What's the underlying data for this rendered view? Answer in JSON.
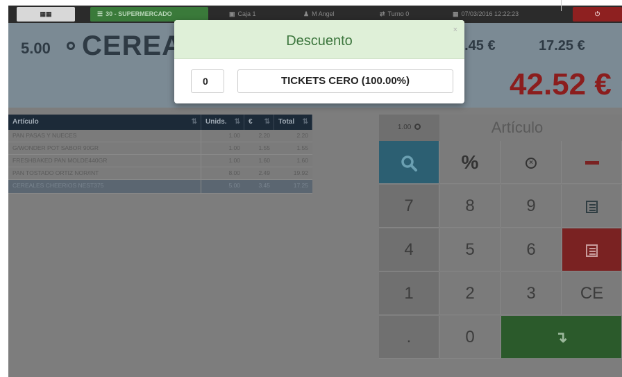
{
  "topbar": {
    "store_label": "30 - SUPERMERCADO",
    "register_label": "Caja 1",
    "user_label": "M Angel",
    "shift_label": "Turno 0",
    "datetime": "07/03/2016 12:22:23"
  },
  "display": {
    "quantity": "5.00",
    "article_name": "CEREAL",
    "unit_price": "3.45 €",
    "line_total": "17.25 €",
    "ticket_total": "42.52 €"
  },
  "table": {
    "headers": [
      "Artículo",
      "Unids.",
      "€",
      "Total"
    ],
    "rows": [
      [
        "PAN PASAS Y NUECES",
        "1.00",
        "2.20",
        "2.20"
      ],
      [
        "G/WONDER POT SABOR 90GR",
        "1.00",
        "1.55",
        "1.55"
      ],
      [
        "FRESHBAKED PAN MOLDE440GR",
        "1.00",
        "1.60",
        "1.60"
      ],
      [
        "PAN TOSTADO ORTIZ NOR/INT",
        "8.00",
        "2.49",
        "19.92"
      ],
      [
        "CEREALES CHEERIOS NEST375",
        "5.00",
        "3.45",
        "17.25"
      ]
    ]
  },
  "keypad": {
    "qty_value": "1.00",
    "article_label": "Artículo",
    "percent": "%",
    "k7": "7",
    "k8": "8",
    "k9": "9",
    "k4": "4",
    "k5": "5",
    "k6": "6",
    "k1": "1",
    "k2": "2",
    "k3": "3",
    "ce": "CE",
    "dot": ".",
    "k0": "0"
  },
  "modal": {
    "title": "Descuento",
    "close": "×",
    "input_value": "0",
    "option_label": "TICKETS CERO (100.00%)"
  },
  "colors": {
    "modal_header": "#dff0d8",
    "modal_title": "#3c763d",
    "total_red": "#8b1d1d"
  },
  "icons": [
    "menu-grid-icon",
    "list-icon",
    "register-icon",
    "user-icon",
    "shift-icon",
    "calendar-icon",
    "power-icon",
    "search-icon",
    "cancel-circle-icon",
    "minus-icon",
    "list-icon",
    "enter-arrow-icon"
  ]
}
